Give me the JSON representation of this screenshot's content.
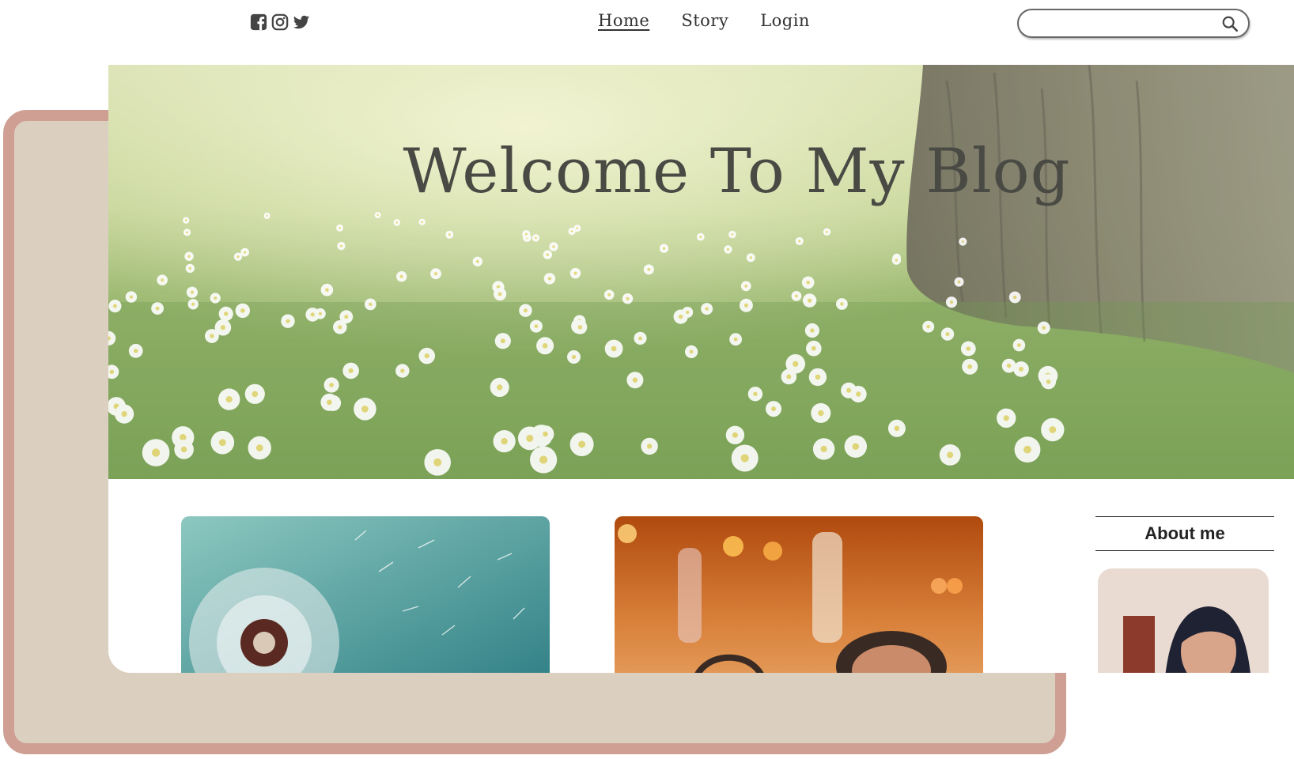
{
  "social": {
    "icons": [
      "facebook-square-icon",
      "instagram-icon",
      "twitter-icon"
    ]
  },
  "nav": {
    "items": [
      {
        "label": "Home",
        "active": true
      },
      {
        "label": "Story",
        "active": false
      },
      {
        "label": "Login",
        "active": false
      }
    ]
  },
  "search": {
    "value": "",
    "placeholder": "",
    "icon": "search-icon"
  },
  "hero": {
    "title": "Welcome To My Blog",
    "image": "meadow-with-white-flowers-and-tree"
  },
  "posts": [
    {
      "image": "dandelion-seeds"
    },
    {
      "image": "headphones-bokeh"
    }
  ],
  "sidebar": {
    "about_title": "About me",
    "avatar": "author-portrait"
  },
  "colors": {
    "panel_fill": "#dbcfc0",
    "panel_border": "#cf9f94",
    "text": "#333333"
  }
}
